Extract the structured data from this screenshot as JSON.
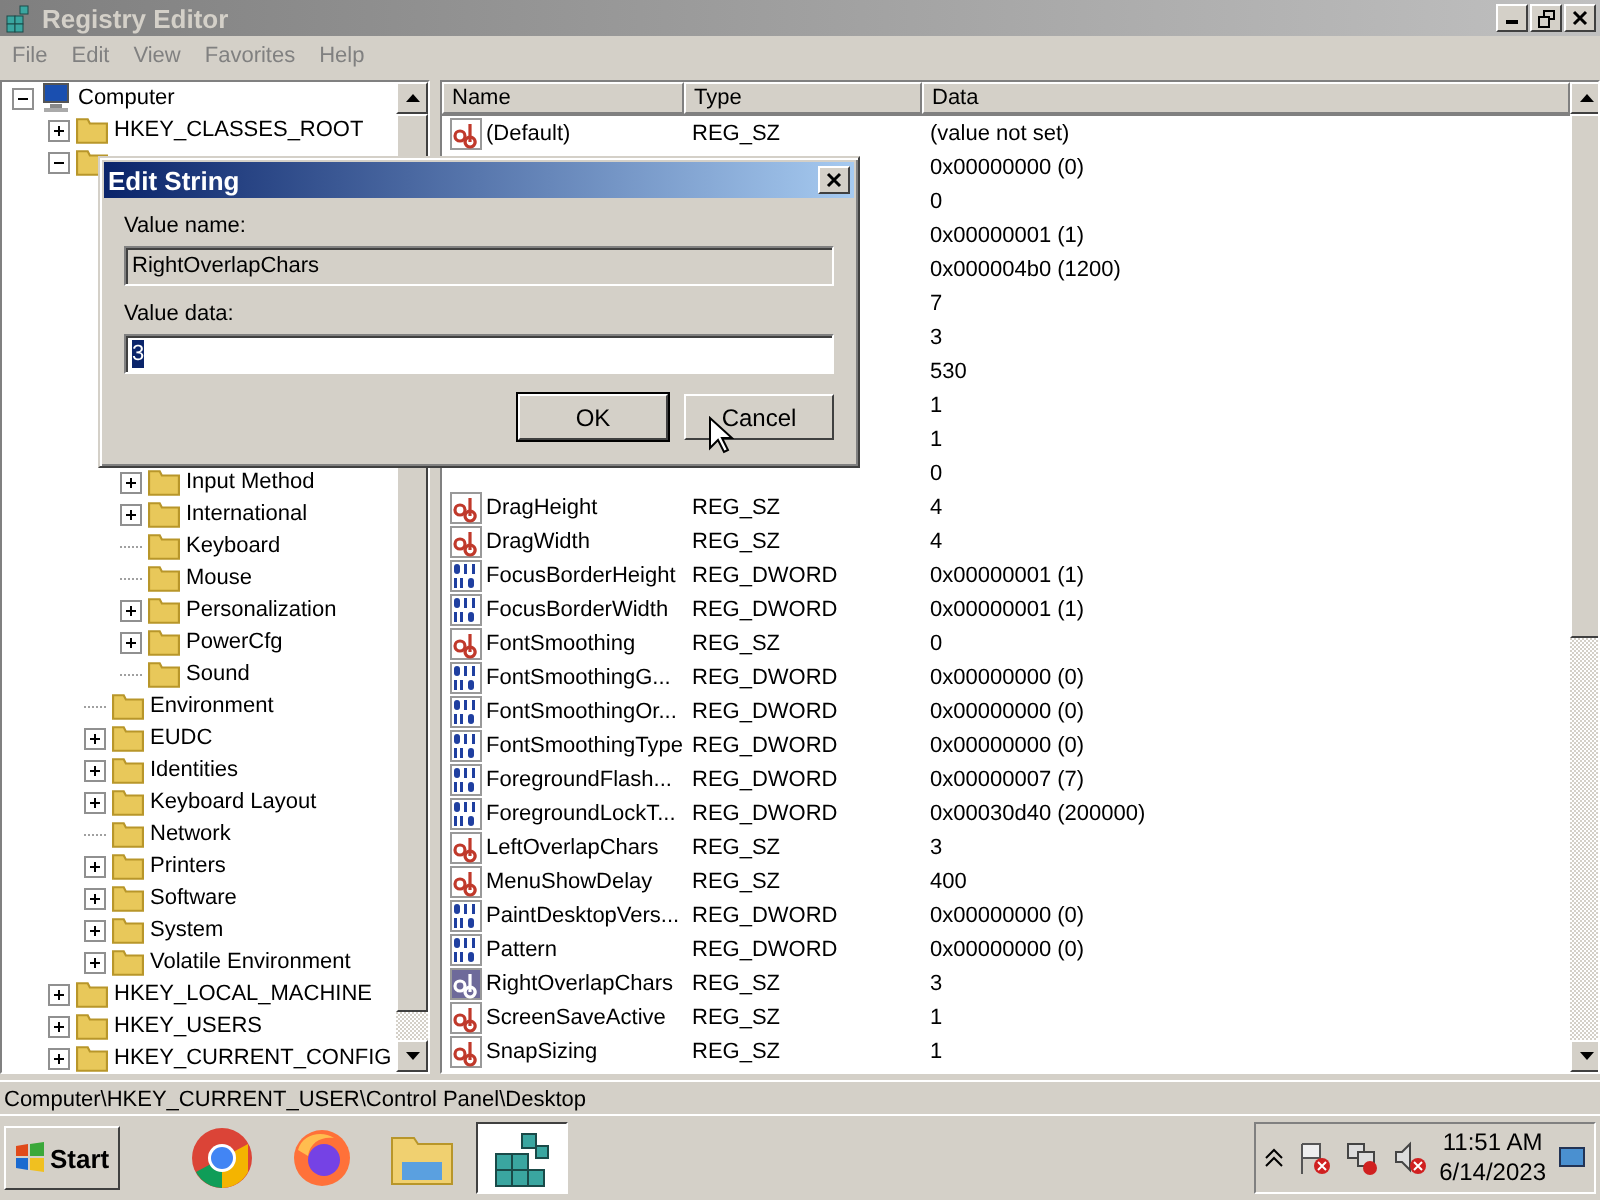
{
  "window": {
    "title": "Registry Editor"
  },
  "menu": [
    "File",
    "Edit",
    "View",
    "Favorites",
    "Help"
  ],
  "tree": [
    {
      "kind": "computer",
      "label": "Computer",
      "has_children": true,
      "expanded": true,
      "children": [
        {
          "kind": "folder",
          "label": "HKEY_CLASSES_ROOT",
          "has_children": true,
          "expanded": false
        },
        {
          "kind": "folder",
          "has_children": true,
          "expanded": true,
          "children": [
            {
              "kind": "covered"
            },
            {
              "kind": "covered"
            },
            {
              "kind": "covered",
              "children": [
                {
                  "kind": "covered"
                },
                {
                  "kind": "covered"
                },
                {
                  "kind": "covered"
                },
                {
                  "kind": "covered"
                },
                {
                  "kind": "covered"
                },
                {
                  "kind": "covered"
                },
                {
                  "kind": "folder",
                  "label": "Input Method",
                  "has_children": true,
                  "expanded": false
                },
                {
                  "kind": "folder",
                  "label": "International",
                  "has_children": true,
                  "expanded": false
                },
                {
                  "kind": "folder",
                  "label": "Keyboard",
                  "has_children": false,
                  "expanded": false
                },
                {
                  "kind": "folder",
                  "label": "Mouse",
                  "has_children": false,
                  "expanded": false
                },
                {
                  "kind": "folder",
                  "label": "Personalization",
                  "has_children": true,
                  "expanded": false
                },
                {
                  "kind": "folder",
                  "label": "PowerCfg",
                  "has_children": true,
                  "expanded": false
                },
                {
                  "kind": "folder",
                  "label": "Sound",
                  "has_children": false,
                  "expanded": false
                }
              ]
            },
            {
              "kind": "folder",
              "label": "Environment",
              "has_children": false,
              "expanded": false
            },
            {
              "kind": "folder",
              "label": "EUDC",
              "has_children": true,
              "expanded": false
            },
            {
              "kind": "folder",
              "label": "Identities",
              "has_children": true,
              "expanded": false
            },
            {
              "kind": "folder",
              "label": "Keyboard Layout",
              "has_children": true,
              "expanded": false
            },
            {
              "kind": "folder",
              "label": "Network",
              "has_children": false,
              "expanded": false
            },
            {
              "kind": "folder",
              "label": "Printers",
              "has_children": true,
              "expanded": false
            },
            {
              "kind": "folder",
              "label": "Software",
              "has_children": true,
              "expanded": false
            },
            {
              "kind": "folder",
              "label": "System",
              "has_children": true,
              "expanded": false
            },
            {
              "kind": "folder",
              "label": "Volatile Environment",
              "has_children": true,
              "expanded": false
            }
          ]
        },
        {
          "kind": "folder",
          "label": "HKEY_LOCAL_MACHINE",
          "has_children": true,
          "expanded": false
        },
        {
          "kind": "folder",
          "label": "HKEY_USERS",
          "has_children": true,
          "expanded": false
        },
        {
          "kind": "folder",
          "label": "HKEY_CURRENT_CONFIG",
          "has_children": true,
          "expanded": false
        }
      ]
    }
  ],
  "table": {
    "columns": [
      "Name",
      "Type",
      "Data"
    ],
    "rows": [
      {
        "kind": "sz",
        "name": "(Default)",
        "type": "REG_SZ",
        "data": "(value not set)",
        "selected": false
      },
      {
        "kind": "covered",
        "data": "0x00000000 (0)",
        "selected": false
      },
      {
        "kind": "covered",
        "data": "0",
        "selected": false
      },
      {
        "kind": "covered",
        "data": "0x00000001 (1)",
        "selected": false
      },
      {
        "kind": "covered",
        "data": "0x000004b0 (1200)",
        "selected": false
      },
      {
        "kind": "covered",
        "data": "7",
        "selected": false
      },
      {
        "kind": "covered",
        "data": "3",
        "selected": false
      },
      {
        "kind": "covered",
        "data": "530",
        "selected": false
      },
      {
        "kind": "covered",
        "data": "1",
        "selected": false
      },
      {
        "kind": "covered",
        "data": "1",
        "selected": false
      },
      {
        "kind": "covered",
        "data": "0",
        "selected": false
      },
      {
        "kind": "sz",
        "name": "DragHeight",
        "type": "REG_SZ",
        "data": "4",
        "selected": false
      },
      {
        "kind": "sz",
        "name": "DragWidth",
        "type": "REG_SZ",
        "data": "4",
        "selected": false
      },
      {
        "kind": "dword",
        "name": "FocusBorderHeight",
        "type": "REG_DWORD",
        "data": "0x00000001 (1)",
        "selected": false
      },
      {
        "kind": "dword",
        "name": "FocusBorderWidth",
        "type": "REG_DWORD",
        "data": "0x00000001 (1)",
        "selected": false
      },
      {
        "kind": "sz",
        "name": "FontSmoothing",
        "type": "REG_SZ",
        "data": "0",
        "selected": false
      },
      {
        "kind": "dword",
        "name": "FontSmoothingG...",
        "type": "REG_DWORD",
        "data": "0x00000000 (0)",
        "selected": false
      },
      {
        "kind": "dword",
        "name": "FontSmoothingOr...",
        "type": "REG_DWORD",
        "data": "0x00000000 (0)",
        "selected": false
      },
      {
        "kind": "dword",
        "name": "FontSmoothingType",
        "type": "REG_DWORD",
        "data": "0x00000000 (0)",
        "selected": false
      },
      {
        "kind": "dword",
        "name": "ForegroundFlash...",
        "type": "REG_DWORD",
        "data": "0x00000007 (7)",
        "selected": false
      },
      {
        "kind": "dword",
        "name": "ForegroundLockT...",
        "type": "REG_DWORD",
        "data": "0x00030d40 (200000)",
        "selected": false
      },
      {
        "kind": "sz",
        "name": "LeftOverlapChars",
        "type": "REG_SZ",
        "data": "3",
        "selected": false
      },
      {
        "kind": "sz",
        "name": "MenuShowDelay",
        "type": "REG_SZ",
        "data": "400",
        "selected": false
      },
      {
        "kind": "dword",
        "name": "PaintDesktopVers...",
        "type": "REG_DWORD",
        "data": "0x00000000 (0)",
        "selected": false
      },
      {
        "kind": "dword",
        "name": "Pattern",
        "type": "REG_DWORD",
        "data": "0x00000000 (0)",
        "selected": false
      },
      {
        "kind": "sz",
        "name": "RightOverlapChars",
        "type": "REG_SZ",
        "data": "3",
        "selected": true
      },
      {
        "kind": "sz",
        "name": "ScreenSaveActive",
        "type": "REG_SZ",
        "data": "1",
        "selected": false
      },
      {
        "kind": "sz",
        "name": "SnapSizing",
        "type": "REG_SZ",
        "data": "1",
        "selected": false
      }
    ]
  },
  "status_bar": "Computer\\HKEY_CURRENT_USER\\Control Panel\\Desktop",
  "dialog": {
    "title": "Edit String",
    "name_label": "Value name:",
    "name_value": "RightOverlapChars",
    "data_label": "Value data:",
    "data_value": "3",
    "data_selected": true,
    "buttons": [
      "OK",
      "Cancel"
    ]
  },
  "taskbar": {
    "start": "Start",
    "apps": [
      {
        "kind": "chrome",
        "selected": false
      },
      {
        "kind": "firefox",
        "selected": false
      },
      {
        "kind": "explorer",
        "selected": false
      },
      {
        "kind": "regedit",
        "selected": true
      }
    ],
    "time": "11:51 AM",
    "date": "6/14/2023"
  }
}
